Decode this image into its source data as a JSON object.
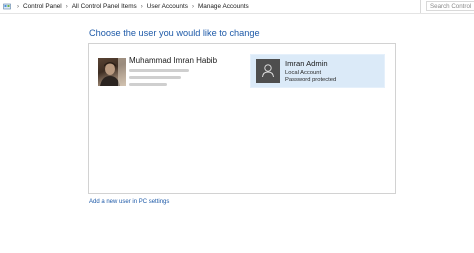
{
  "breadcrumb": {
    "items": [
      "Control Panel",
      "All Control Panel Items",
      "User Accounts",
      "Manage Accounts"
    ]
  },
  "search": {
    "placeholder": "Search Control"
  },
  "main": {
    "title": "Choose the user you would like to change",
    "accounts": [
      {
        "name": "Muhammad Imran Habib"
      },
      {
        "name": "Imran Admin",
        "type": "Local Account",
        "status": "Password protected"
      }
    ],
    "add_user_link": "Add a new user in PC settings"
  },
  "colors": {
    "link": "#1e5aa8",
    "selected_bg": "#dbeaf8",
    "avatar_gray": "#4e4e4e"
  }
}
